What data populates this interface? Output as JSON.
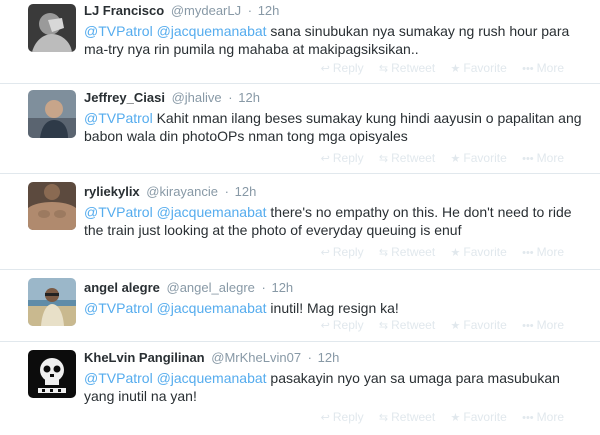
{
  "tweets": [
    {
      "fullname": "LJ Francisco",
      "username": "@mydearLJ",
      "time": "12h",
      "mention1": "@TVPatrol",
      "mention2": "@jacquemanabat",
      "text": "sana sinubukan nya sumakay ng rush hour para ma-try nya rin pumila ng mahaba at makipagsiksikan..",
      "avatar": "person-covering-face-avatar"
    },
    {
      "fullname": "Jeffrey_Ciasi",
      "username": "@jhalive",
      "time": "12h",
      "mention1": "@TVPatrol",
      "mention2": "",
      "text": "Kahit nman ilang beses sumakay kung hindi aayusin o papalitan ang babon wala din photoOPs nman tong mga opisyales",
      "avatar": "person-photo-avatar"
    },
    {
      "fullname": "ryliekylix",
      "username": "@kirayancie",
      "time": "12h",
      "mention1": "@TVPatrol",
      "mention2": "@jacquemanabat",
      "text": "there's no empathy on this. He don't need to ride the train just looking at the photo of everyday queuing is enuf",
      "avatar": "shirtless-person-avatar"
    },
    {
      "fullname": "angel alegre",
      "username": "@angel_alegre",
      "time": "12h",
      "mention1": "@TVPatrol",
      "mention2": "@jacquemanabat",
      "text": "inutil! Mag resign ka!",
      "avatar": "person-at-beach-avatar"
    },
    {
      "fullname": "KheLvin Pangilinan",
      "username": "@MrKheLvin07",
      "time": "12h",
      "mention1": "@TVPatrol",
      "mention2": "@jacquemanabat",
      "text": "pasakayin nyo yan sa umaga para masubukan yang inutil na yan!",
      "avatar": "skull-logo-avatar"
    }
  ],
  "actions": {
    "reply": "Reply",
    "retweet": "Retweet",
    "favorite": "Favorite",
    "more": "More"
  },
  "colors": {
    "mention": "#55acee",
    "meta": "#8899a6",
    "action": "#e1e8ed",
    "border": "#e1e8ed",
    "text": "#292f33"
  }
}
